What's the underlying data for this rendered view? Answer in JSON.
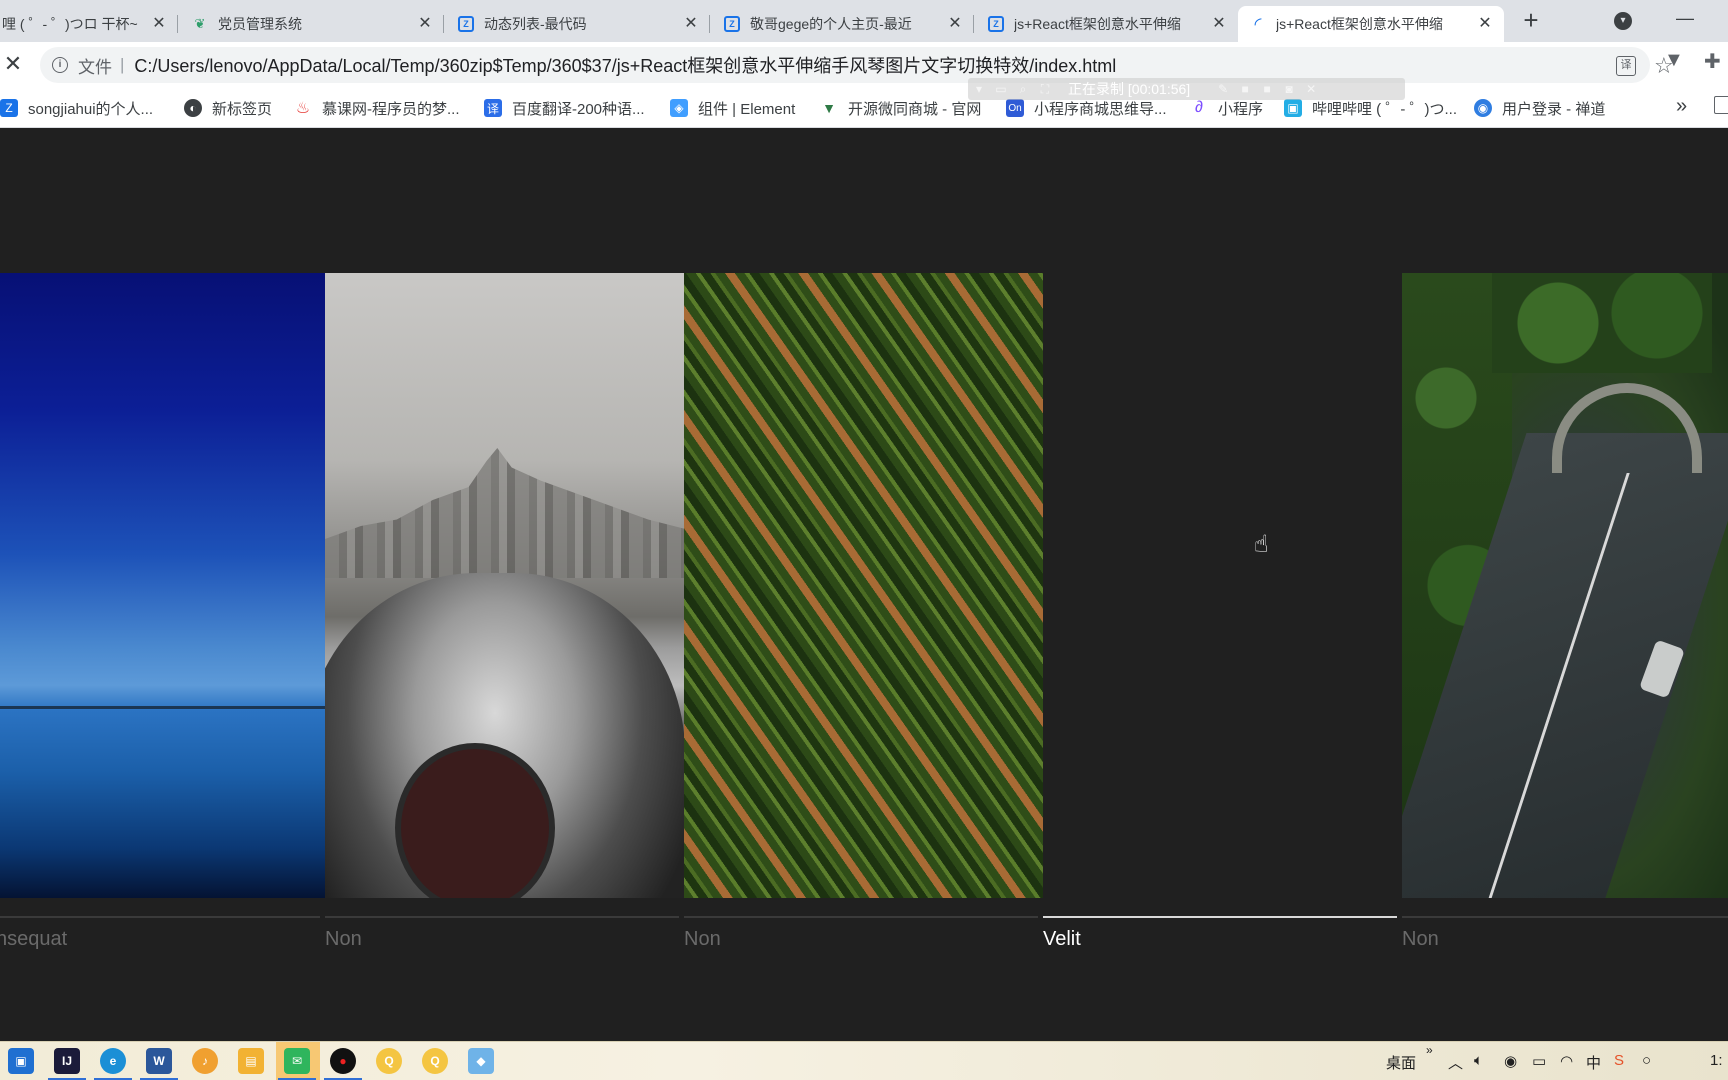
{
  "browser": {
    "tabs": [
      {
        "title": "哩 ( ゜- ゜)つロ 干杯~",
        "icon": "bilibili-icon"
      },
      {
        "title": "党员管理系统",
        "icon": "leaf-icon"
      },
      {
        "title": "动态列表-最代码",
        "icon": "code-icon"
      },
      {
        "title": "敬哥gege的个人主页-最近",
        "icon": "code-icon"
      },
      {
        "title": "js+React框架创意水平伸缩",
        "icon": "code-icon"
      },
      {
        "title": "js+React框架创意水平伸缩",
        "icon": "loading-icon",
        "active": true
      }
    ],
    "new_tab_label": "+",
    "address": {
      "scheme_label": "文件",
      "separator": "|",
      "url": "C:/Users/lenovo/AppData/Local/Temp/360zip$Temp/360$37/js+React框架创意水平伸缩手风琴图片文字切换特效/index.html"
    },
    "bookmarks": [
      {
        "label": "songjiahui的个人...",
        "icon": "code-icon",
        "color": "#1a73e8"
      },
      {
        "label": "新标签页",
        "icon": "globe-icon",
        "color": "#3c4043"
      },
      {
        "label": "慕课网-程序员的梦...",
        "icon": "flame-icon",
        "color": "#e53935"
      },
      {
        "label": "百度翻译-200种语...",
        "icon": "translate-icon",
        "color": "#2b6de8"
      },
      {
        "label": "组件 | Element",
        "icon": "element-icon",
        "color": "#409eff"
      },
      {
        "label": "开源微同商城 - 官网",
        "icon": "vue-icon",
        "color": "#2f7a46"
      },
      {
        "label": "小程序商城思维导...",
        "icon": "on-icon",
        "color": "#2f5bd6"
      },
      {
        "label": "小程序",
        "icon": "link-icon",
        "color": "#7c4dff"
      },
      {
        "label": "哔哩哔哩 ( ゜- ゜)つ...",
        "icon": "bilibili-icon",
        "color": "#23ade5"
      },
      {
        "label": "用户登录 - 禅道",
        "icon": "zentao-icon",
        "color": "#2f7de1"
      }
    ],
    "more_bookmarks": "»"
  },
  "recording_overlay": {
    "text": "正在录制 [00:01:56]"
  },
  "accordion": {
    "panels": [
      {
        "caption": "nsequat",
        "image": "blue-sea",
        "active": false
      },
      {
        "caption": "Non",
        "image": "city-viewer",
        "active": false
      },
      {
        "caption": "Non",
        "image": "farm-rows",
        "active": false
      },
      {
        "caption": "Velit",
        "image": "none",
        "active": true
      },
      {
        "caption": "Non",
        "image": "tunnel-road",
        "active": false
      }
    ],
    "colors": {
      "background": "#202020",
      "active_caption": "#ffffff",
      "inactive_caption": "#6a6a6a"
    }
  },
  "taskbar": {
    "apps": [
      "start-icon",
      "intellij-icon",
      "edge-icon",
      "word-icon",
      "music-icon",
      "files-icon",
      "wechat-icon",
      "record-icon",
      "qq-icon",
      "qq-icon",
      "app-icon"
    ],
    "desktop_label": "桌面",
    "tray_clock": "1:"
  }
}
